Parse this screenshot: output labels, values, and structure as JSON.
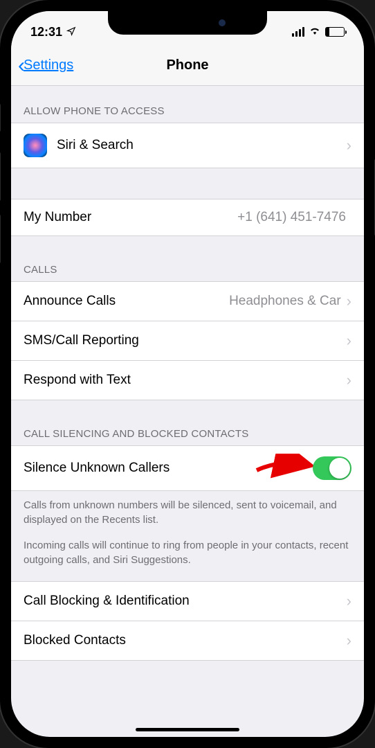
{
  "status": {
    "time": "12:31"
  },
  "nav": {
    "back_label": "Settings",
    "title": "Phone"
  },
  "sections": {
    "access_header": "ALLOW PHONE TO ACCESS",
    "siri_label": "Siri & Search",
    "my_number_label": "My Number",
    "my_number_value": "+1 (641) 451-7476",
    "calls_header": "CALLS",
    "announce_label": "Announce Calls",
    "announce_value": "Headphones & Car",
    "sms_label": "SMS/Call Reporting",
    "respond_label": "Respond with Text",
    "silencing_header": "CALL SILENCING AND BLOCKED CONTACTS",
    "silence_label": "Silence Unknown Callers",
    "silence_toggle": true,
    "footer1": "Calls from unknown numbers will be silenced, sent to voicemail, and displayed on the Recents list.",
    "footer2": "Incoming calls will continue to ring from people in your contacts, recent outgoing calls, and Siri Suggestions.",
    "blocking_label": "Call Blocking & Identification",
    "blocked_label": "Blocked Contacts"
  }
}
